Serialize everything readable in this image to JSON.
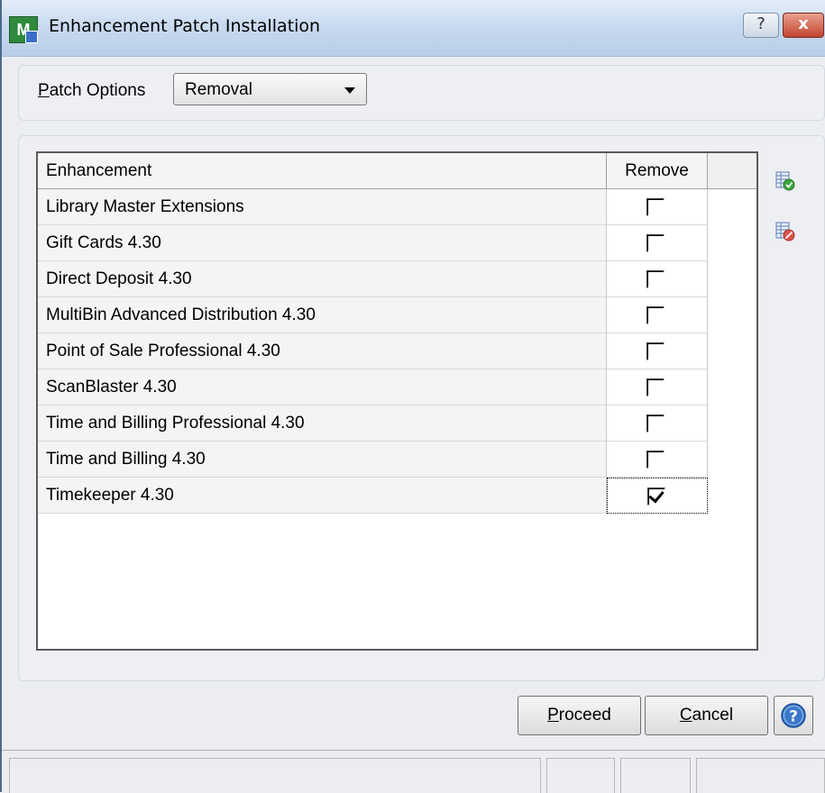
{
  "window": {
    "title": "Enhancement Patch Installation",
    "help_button": "?",
    "close_button": "x"
  },
  "patch_options": {
    "label": "Patch Options",
    "selected": "Removal"
  },
  "grid": {
    "columns": [
      "Enhancement",
      "Remove"
    ],
    "rows": [
      {
        "name": "Library Master Extensions",
        "remove": false
      },
      {
        "name": "Gift Cards 4.30",
        "remove": false
      },
      {
        "name": "Direct Deposit 4.30",
        "remove": false
      },
      {
        "name": "MultiBin Advanced Distribution 4.30",
        "remove": false
      },
      {
        "name": "Point of Sale Professional 4.30",
        "remove": false
      },
      {
        "name": "ScanBlaster 4.30",
        "remove": false
      },
      {
        "name": "Time and Billing Professional 4.30",
        "remove": false
      },
      {
        "name": "Time and Billing 4.30",
        "remove": false
      },
      {
        "name": "Timekeeper 4.30",
        "remove": true
      }
    ]
  },
  "side_icons": [
    "select-all-icon",
    "clear-all-icon"
  ],
  "buttons": {
    "proceed": "Proceed",
    "cancel": "Cancel"
  },
  "colors": {
    "check_green": "#3da640",
    "clear_red": "#d9534f",
    "help_blue": "#3a78c9"
  }
}
